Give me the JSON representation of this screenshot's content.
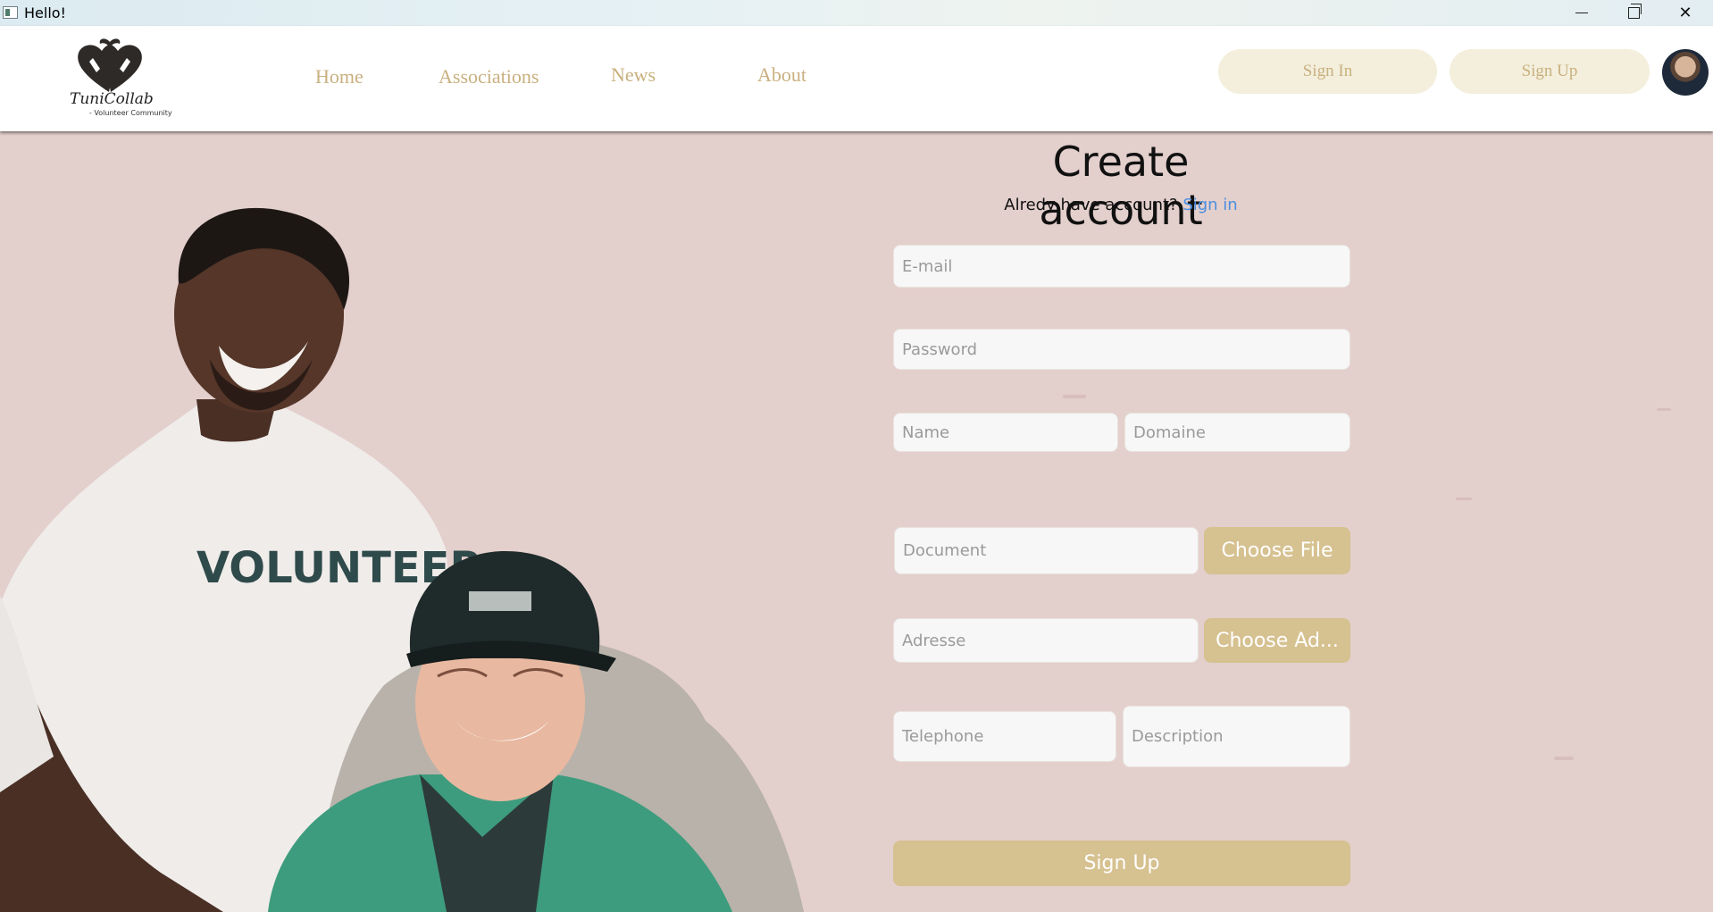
{
  "window": {
    "title": "Hello!"
  },
  "header": {
    "logo": {
      "name": "TuniCollab",
      "tagline": "- Volunteer Community"
    },
    "nav": [
      "Home",
      "Associations",
      "News",
      "About"
    ],
    "sign_in_label": "Sign In",
    "sign_up_label": "Sign Up"
  },
  "hero": {
    "shirt_text": "VOLUNTEER"
  },
  "form": {
    "title": "Create account",
    "have_account_text": "Alredy have account?",
    "sign_in_link": "Sign in",
    "email_placeholder": "E-mail",
    "password_placeholder": "Password",
    "name_placeholder": "Name",
    "domaine_placeholder": "Domaine",
    "document_placeholder": "Document",
    "choose_file_label": "Choose File",
    "adresse_placeholder": "Adresse",
    "choose_address_label": "Choose Ad...",
    "telephone_placeholder": "Telephone",
    "description_placeholder": "Description",
    "submit_label": "Sign Up"
  },
  "colors": {
    "accent_gold": "#d6c190",
    "nav_text": "#c9b07f",
    "pill_bg": "#f3efdc",
    "link_blue": "#4a8fe0",
    "wall": "#e3cfcc"
  },
  "icons": [
    "app-icon",
    "minimize-icon",
    "maximize-icon",
    "close-icon",
    "heart-hands-logo-icon",
    "user-avatar-icon"
  ]
}
